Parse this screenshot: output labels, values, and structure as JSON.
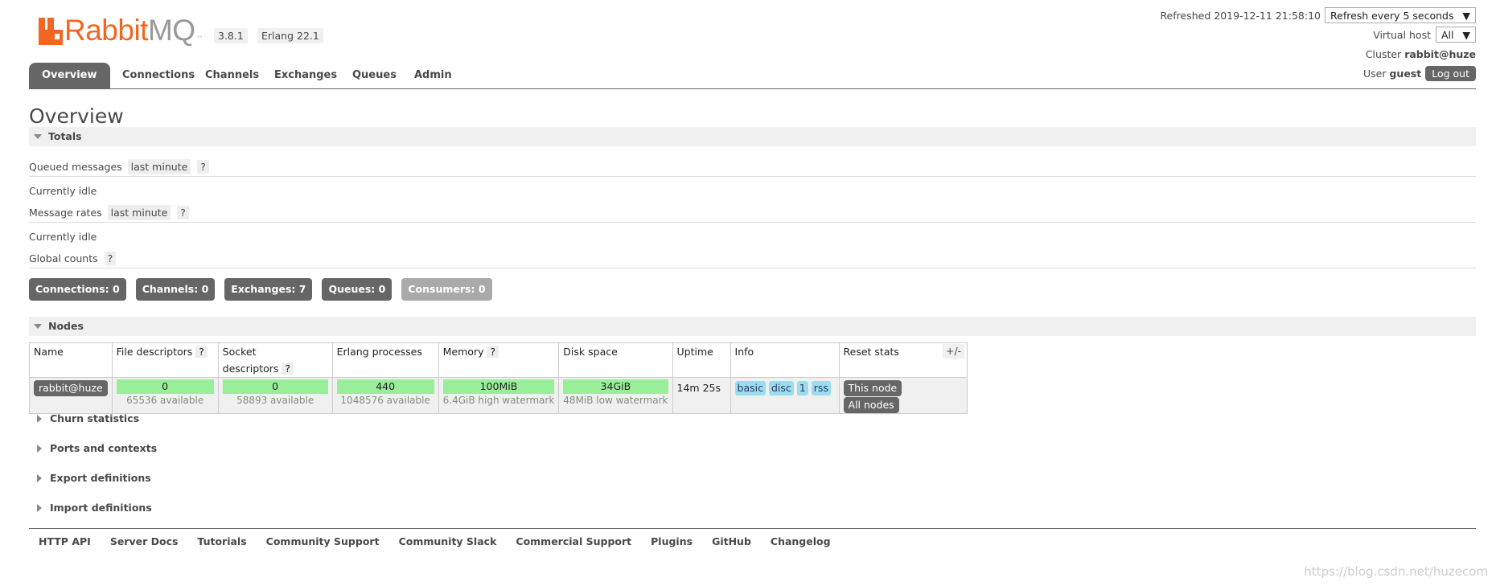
{
  "brand": {
    "name_first": "Rabbit",
    "name_second": "MQ",
    "tm": "™",
    "version": "3.8.1",
    "erlang": "Erlang 22.1"
  },
  "header": {
    "refreshed_label": "Refreshed 2019-12-11 21:58:10",
    "refresh_select": "Refresh every 5 seconds",
    "vhost_label": "Virtual host",
    "vhost_select": "All",
    "cluster_label": "Cluster",
    "cluster_value": "rabbit@huze",
    "user_label": "User",
    "user_value": "guest",
    "logout": "Log out"
  },
  "tabs": [
    {
      "label": "Overview",
      "active": true
    },
    {
      "label": "Connections"
    },
    {
      "label": "Channels"
    },
    {
      "label": "Exchanges"
    },
    {
      "label": "Queues"
    },
    {
      "label": "Admin"
    }
  ],
  "page_title": "Overview",
  "totals": {
    "title": "Totals",
    "queued_label": "Queued messages",
    "queued_range": "last minute",
    "help": "?",
    "queued_state": "Currently idle",
    "rates_label": "Message rates",
    "rates_range": "last minute",
    "rates_state": "Currently idle",
    "global_label": "Global counts"
  },
  "counts": [
    {
      "label": "Connections:",
      "value": "0"
    },
    {
      "label": "Channels:",
      "value": "0"
    },
    {
      "label": "Exchanges:",
      "value": "7"
    },
    {
      "label": "Queues:",
      "value": "0"
    },
    {
      "label": "Consumers:",
      "value": "0"
    }
  ],
  "nodes": {
    "title": "Nodes",
    "columns": [
      "Name",
      "File descriptors",
      "Socket descriptors",
      "Erlang processes",
      "Memory",
      "Disk space",
      "Uptime",
      "Info",
      "Reset stats"
    ],
    "row": {
      "name": "rabbit@huze",
      "fd": "0",
      "fd_sub": "65536 available",
      "sd": "0",
      "sd_sub": "58893 available",
      "ep": "440",
      "ep_sub": "1048576 available",
      "mem": "100MiB",
      "mem_sub": "6.4GiB high watermark",
      "disk": "34GiB",
      "disk_sub": "48MiB low watermark",
      "uptime": "14m 25s",
      "info": [
        "basic",
        "disc",
        "1",
        "rss"
      ],
      "reset_this": "This node",
      "reset_all": "All nodes"
    },
    "plusminus": "+/-"
  },
  "collapsed_sections": [
    "Churn statistics",
    "Ports and contexts",
    "Export definitions",
    "Import definitions"
  ],
  "footer": [
    "HTTP API",
    "Server Docs",
    "Tutorials",
    "Community Support",
    "Community Slack",
    "Commercial Support",
    "Plugins",
    "GitHub",
    "Changelog"
  ],
  "watermark": "https://blog.csdn.net/huzecom",
  "colors": {
    "brand": "#f26522",
    "tab_active": "#666666",
    "bar": "#99ee99",
    "tag": "#99ddee"
  }
}
